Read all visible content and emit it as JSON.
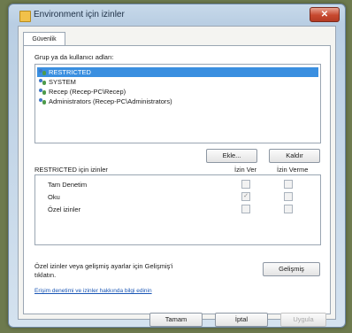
{
  "window": {
    "title": "Environment için izinler",
    "close_glyph": "✕"
  },
  "tabs": [
    {
      "label": "Güvenlik"
    }
  ],
  "groups": {
    "label": "Grup ya da kullanıcı adları:",
    "items": [
      {
        "label": "RESTRICTED",
        "selected": true,
        "icon": "group-icon"
      },
      {
        "label": "SYSTEM",
        "selected": false,
        "icon": "group-icon"
      },
      {
        "label": "Recep (Recep-PC\\Recep)",
        "selected": false,
        "icon": "user-icon"
      },
      {
        "label": "Administrators (Recep-PC\\Administrators)",
        "selected": false,
        "icon": "group-icon"
      }
    ],
    "add_label": "Ekle...",
    "remove_label": "Kaldır"
  },
  "permissions": {
    "header": "RESTRICTED için izinler",
    "allow_header": "İzin Ver",
    "deny_header": "İzin Verme",
    "rows": [
      {
        "name": "Tam Denetim",
        "allow": false,
        "deny": false
      },
      {
        "name": "Oku",
        "allow": true,
        "deny": false
      },
      {
        "name": "Özel izinler",
        "allow": false,
        "deny": false
      }
    ],
    "checkmark": "✓"
  },
  "advanced": {
    "text": "Özel izinler veya gelişmiş ayarlar için Gelişmiş'i tıklatın.",
    "button_label": "Gelişmiş"
  },
  "link": {
    "text": "Erişim denetimi ve izinler hakkında bilgi edinin"
  },
  "footer": {
    "ok_label": "Tamam",
    "cancel_label": "İptal",
    "apply_label": "Uygula"
  }
}
